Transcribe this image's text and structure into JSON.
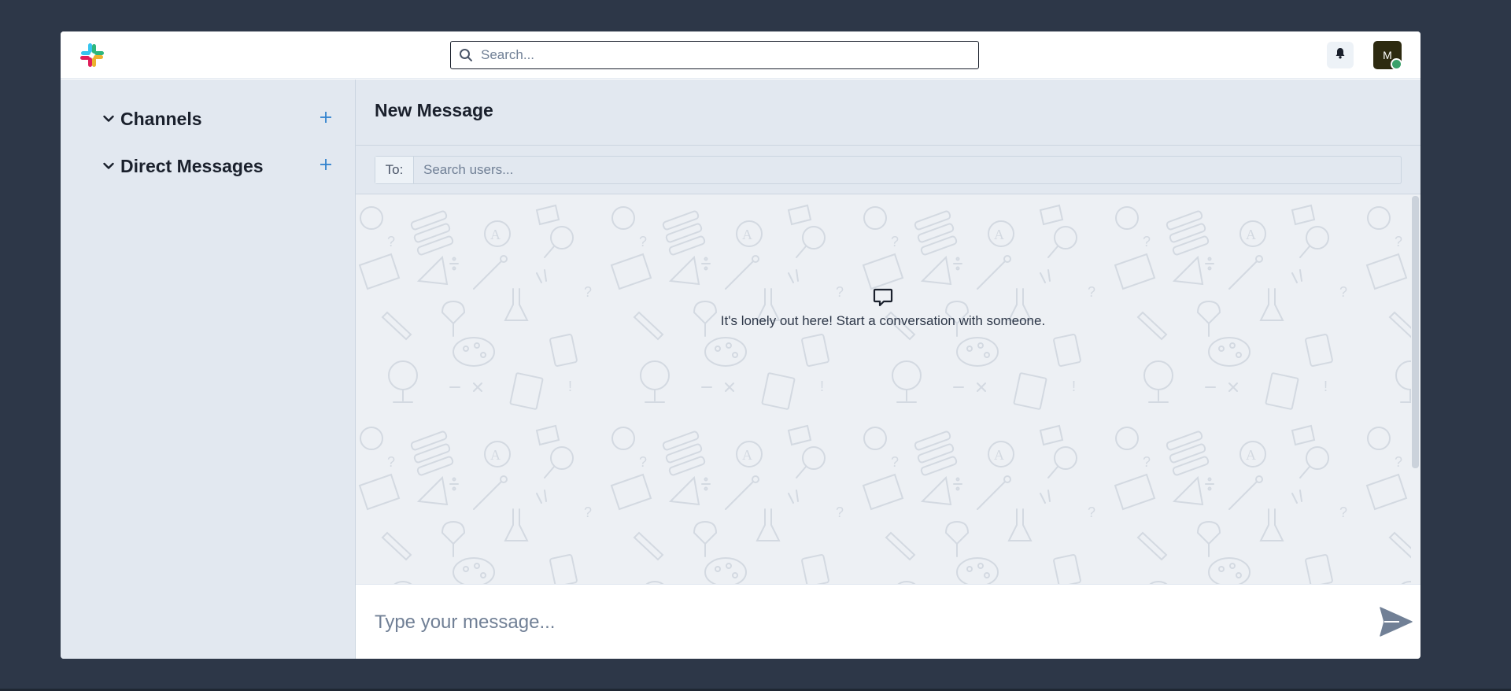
{
  "header": {
    "search_placeholder": "Search...",
    "avatar_initial": "M",
    "presence_color": "#38a169"
  },
  "sidebar": {
    "sections": [
      {
        "label": "Channels",
        "icon": "chevron-down-icon",
        "action_icon": "plus-icon"
      },
      {
        "label": "Direct Messages",
        "icon": "chevron-down-icon",
        "action_icon": "plus-icon"
      }
    ]
  },
  "main": {
    "title": "New Message",
    "to_label": "To:",
    "to_placeholder": "Search users...",
    "empty_state_text": "It's lonely out here! Start a conversation with someone.",
    "empty_state_icon": "chat-bubble-icon",
    "composer_placeholder": "Type your message...",
    "send_icon": "send-icon"
  },
  "colors": {
    "accent": "#3182ce",
    "page_background": "#2d3748",
    "sidebar_background": "#e2e8f0",
    "send_icon": "#718096"
  }
}
